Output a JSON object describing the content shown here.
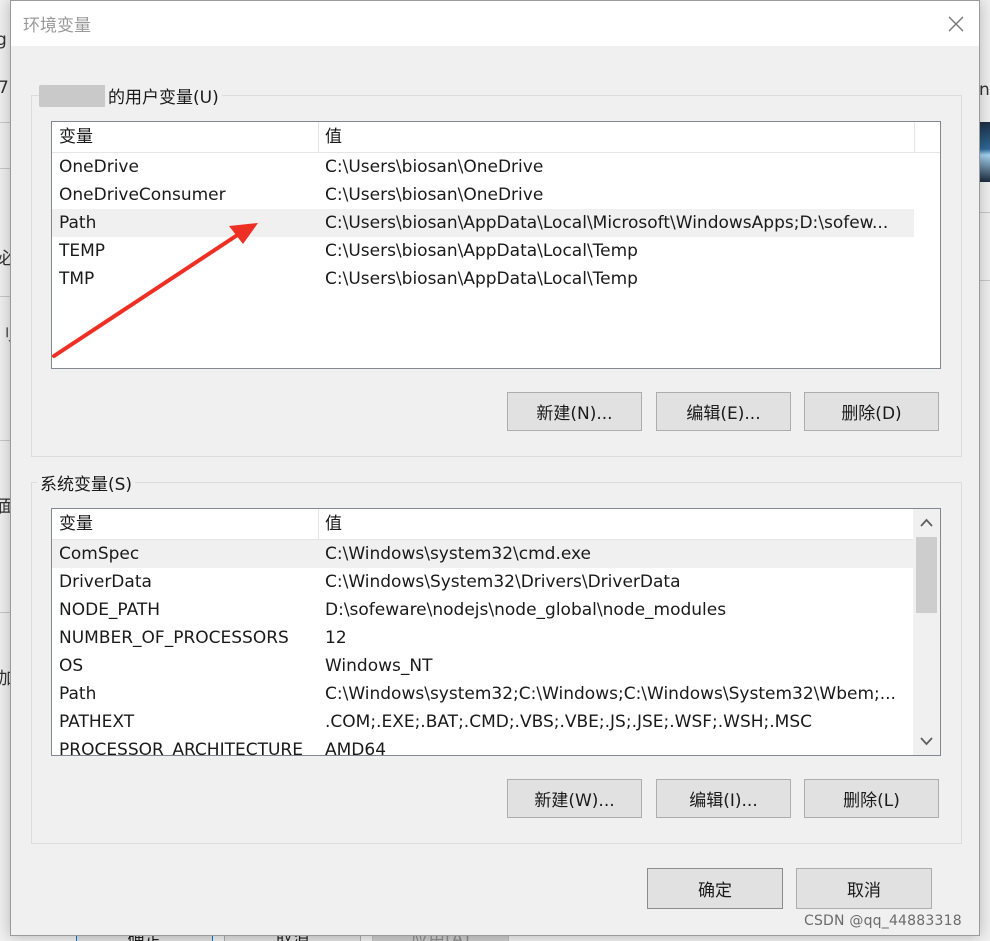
{
  "dialog": {
    "title": "环境变量",
    "close_glyph": "✕"
  },
  "background_window": {
    "fragments": [
      "g",
      "7.",
      "必",
      "刂",
      "面",
      "加",
      "nt"
    ],
    "buttons": {
      "ok_label": "确定",
      "cancel_label": "取消",
      "apply_label": "应用(A)"
    }
  },
  "user_vars": {
    "group_label": "的用户变量(U)",
    "columns": [
      "变量",
      "值"
    ],
    "rows": [
      {
        "name": "OneDrive",
        "value": "C:\\Users\\biosan\\OneDrive"
      },
      {
        "name": "OneDriveConsumer",
        "value": "C:\\Users\\biosan\\OneDrive"
      },
      {
        "name": "Path",
        "value": "C:\\Users\\biosan\\AppData\\Local\\Microsoft\\WindowsApps;D:\\sofew..."
      },
      {
        "name": "TEMP",
        "value": "C:\\Users\\biosan\\AppData\\Local\\Temp"
      },
      {
        "name": "TMP",
        "value": "C:\\Users\\biosan\\AppData\\Local\\Temp"
      }
    ],
    "selected_index": 2,
    "buttons": {
      "new_label": "新建(N)...",
      "edit_label": "编辑(E)...",
      "delete_label": "删除(D)"
    }
  },
  "system_vars": {
    "group_label": "系统变量(S)",
    "columns": [
      "变量",
      "值"
    ],
    "rows": [
      {
        "name": "ComSpec",
        "value": "C:\\Windows\\system32\\cmd.exe"
      },
      {
        "name": "DriverData",
        "value": "C:\\Windows\\System32\\Drivers\\DriverData"
      },
      {
        "name": "NODE_PATH",
        "value": "D:\\sofeware\\nodejs\\node_global\\node_modules"
      },
      {
        "name": "NUMBER_OF_PROCESSORS",
        "value": "12"
      },
      {
        "name": "OS",
        "value": "Windows_NT"
      },
      {
        "name": "Path",
        "value": "C:\\Windows\\system32;C:\\Windows;C:\\Windows\\System32\\Wbem;..."
      },
      {
        "name": "PATHEXT",
        "value": ".COM;.EXE;.BAT;.CMD;.VBS;.VBE;.JS;.JSE;.WSF;.WSH;.MSC"
      },
      {
        "name": "PROCESSOR_ARCHITECTURE",
        "value": "AMD64"
      }
    ],
    "selected_index": 0,
    "buttons": {
      "new_label": "新建(W)...",
      "edit_label": "编辑(I)...",
      "delete_label": "删除(L)"
    }
  },
  "footer": {
    "ok_label": "确定",
    "cancel_label": "取消"
  },
  "annotation": {
    "color": "#ee2f23"
  },
  "watermark": "CSDN @qq_44883318",
  "colors": {
    "selected_row": "#f0f0f0",
    "list_border": "#828790"
  }
}
